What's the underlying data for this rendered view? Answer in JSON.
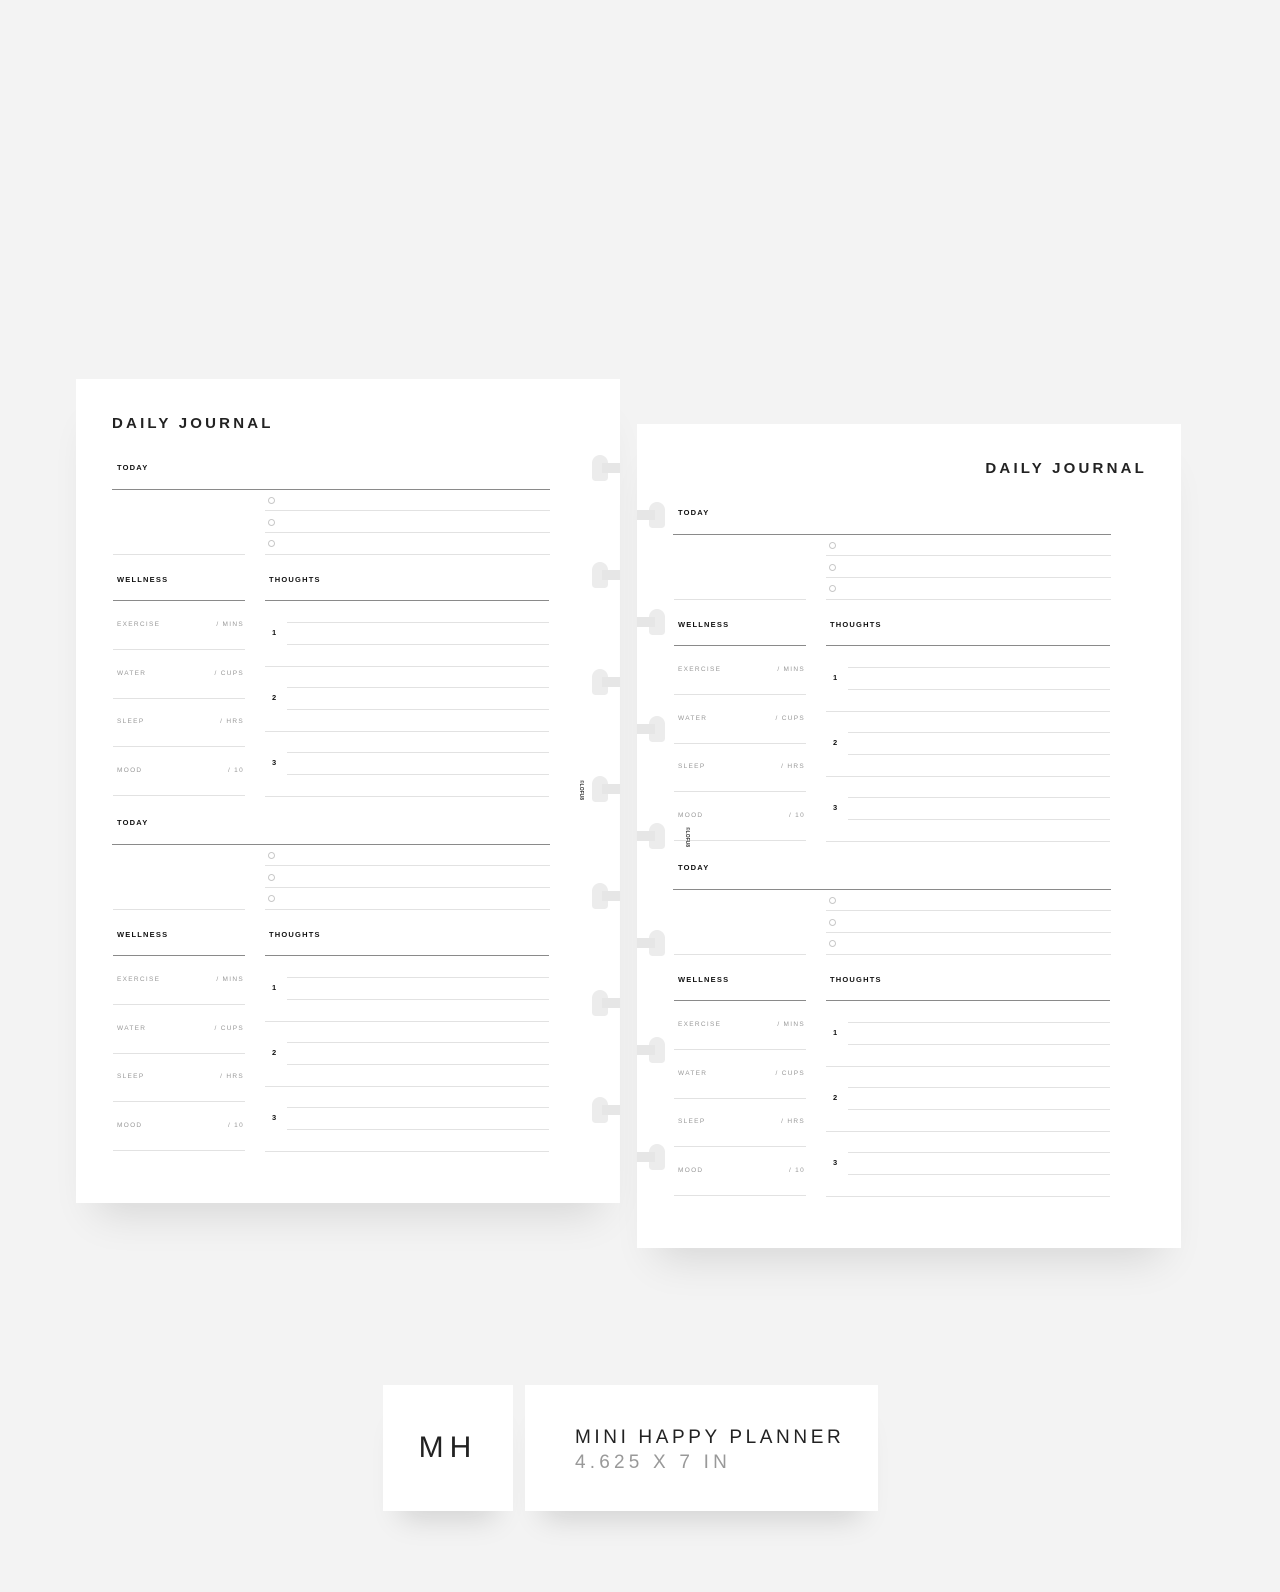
{
  "pages": [
    {
      "id": "left",
      "title": "DAILY JOURNAL",
      "title_align": "left",
      "code": "©LOFU8",
      "sections": [
        {
          "today": "TODAY",
          "wellness": "WELLNESS",
          "thoughts": "THOUGHTS",
          "rows": [
            {
              "label": "EXERCISE",
              "unit": "/ MINS"
            },
            {
              "label": "WATER",
              "unit": "/ CUPS"
            },
            {
              "label": "SLEEP",
              "unit": "/ HRS"
            },
            {
              "label": "MOOD",
              "unit": "/ 10"
            }
          ],
          "numbers": [
            "1",
            "2",
            "3"
          ]
        },
        {
          "today": "TODAY",
          "wellness": "WELLNESS",
          "thoughts": "THOUGHTS",
          "rows": [
            {
              "label": "EXERCISE",
              "unit": "/ MINS"
            },
            {
              "label": "WATER",
              "unit": "/ CUPS"
            },
            {
              "label": "SLEEP",
              "unit": "/ HRS"
            },
            {
              "label": "MOOD",
              "unit": "/ 10"
            }
          ],
          "numbers": [
            "1",
            "2",
            "3"
          ]
        }
      ]
    },
    {
      "id": "right",
      "title": "DAILY JOURNAL",
      "title_align": "right",
      "code": "©LOFU8",
      "sections": [
        {
          "today": "TODAY",
          "wellness": "WELLNESS",
          "thoughts": "THOUGHTS",
          "rows": [
            {
              "label": "EXERCISE",
              "unit": "/ MINS"
            },
            {
              "label": "WATER",
              "unit": "/ CUPS"
            },
            {
              "label": "SLEEP",
              "unit": "/ HRS"
            },
            {
              "label": "MOOD",
              "unit": "/ 10"
            }
          ],
          "numbers": [
            "1",
            "2",
            "3"
          ]
        },
        {
          "today": "TODAY",
          "wellness": "WELLNESS",
          "thoughts": "THOUGHTS",
          "rows": [
            {
              "label": "EXERCISE",
              "unit": "/ MINS"
            },
            {
              "label": "WATER",
              "unit": "/ CUPS"
            },
            {
              "label": "SLEEP",
              "unit": "/ HRS"
            },
            {
              "label": "MOOD",
              "unit": "/ 10"
            }
          ],
          "numbers": [
            "1",
            "2",
            "3"
          ]
        }
      ]
    }
  ],
  "badge": {
    "abbr": "MH",
    "name": "MINI HAPPY PLANNER",
    "size": "4.625 X 7 IN"
  },
  "colors": {
    "background": "#f3f3f3",
    "paper": "#ffffff",
    "text": "#222222",
    "muted": "#999999"
  }
}
